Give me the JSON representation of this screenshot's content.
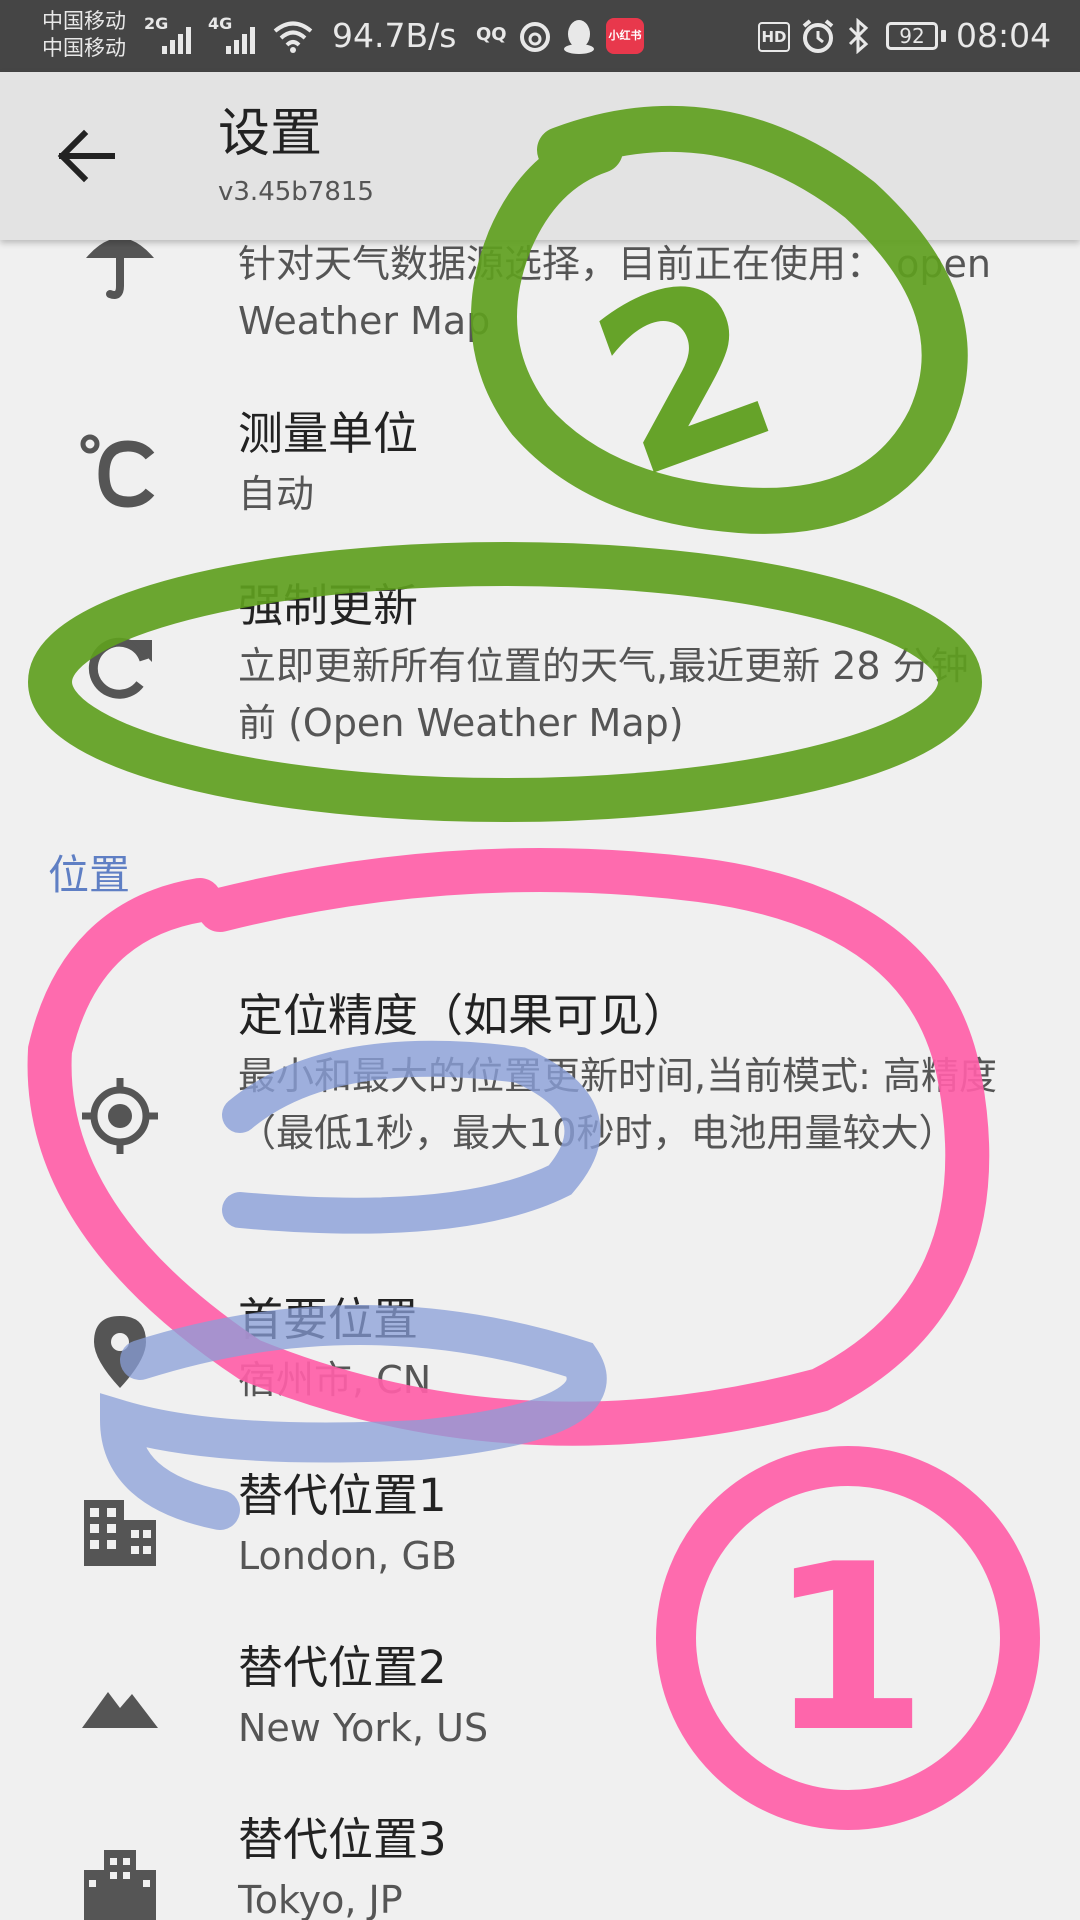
{
  "status_bar": {
    "carrier_1": "中国移动",
    "carrier_2": "中国移动",
    "network_1": "2G",
    "network_2": "4G",
    "speed": "94.7B/s",
    "qq": "QQ",
    "app_badge": "小红书",
    "hd": "HD",
    "battery": "92",
    "time": "08:04"
  },
  "toolbar": {
    "title": "设置",
    "subtitle": "v3.45b7815"
  },
  "settings": {
    "weather_source": {
      "icon": "umbrella-icon",
      "summary": "针对天气数据源选择，目前正在使用： open Weather Map"
    },
    "units": {
      "icon": "celsius-icon",
      "title": "测量单位",
      "summary": "自动"
    },
    "force_update": {
      "icon": "refresh-icon",
      "title": "强制更新",
      "summary": "立即更新所有位置的天气,最近更新 28 分钟 前 (Open Weather Map)"
    }
  },
  "location_section": {
    "header": "位置",
    "accuracy": {
      "icon": "gps-target-icon",
      "title": "定位精度（如果可见）",
      "summary": "最小和最大的位置更新时间,当前模式: 高精度（最低1秒，最大10秒时，电池用量较大）"
    },
    "primary": {
      "icon": "location-pin-icon",
      "title": "首要位置",
      "summary": "宿州市, CN"
    },
    "alt_1": {
      "icon": "building-icon",
      "title": "替代位置1",
      "summary": "London, GB"
    },
    "alt_2": {
      "icon": "mountain-icon",
      "title": "替代位置2",
      "summary": "New York, US"
    },
    "alt_3": {
      "icon": "city-icon",
      "title": "替代位置3",
      "summary": "Tokyo, JP"
    }
  },
  "colors": {
    "accent": "#5f7fc4",
    "status_bar": "#454545",
    "toolbar": "#e3e3e3",
    "background": "#f0f0f0",
    "annotation_green": "#5f9f1f",
    "annotation_pink": "#ff5fa8",
    "annotation_blue": "#8a9fd8"
  },
  "annotations": {
    "number_top": "2",
    "number_bottom": "1"
  }
}
